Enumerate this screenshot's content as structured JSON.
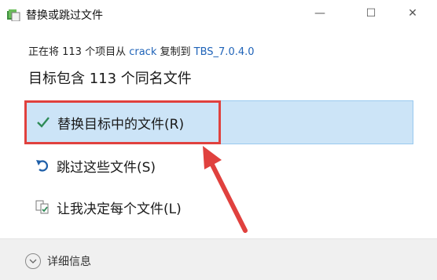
{
  "window": {
    "title": "替换或跳过文件",
    "minimize_glyph": "—",
    "maximize_glyph": "☐",
    "close_glyph": "✕"
  },
  "info": {
    "prefix": "正在将 113 个项目从",
    "source": "crack",
    "middle": "复制到",
    "destination": "TBS_7.0.4.0"
  },
  "heading": "目标包含 113 个同名文件",
  "options": [
    {
      "label": "替换目标中的文件(R)",
      "icon": "checkmark-icon"
    },
    {
      "label": "跳过这些文件(S)",
      "icon": "skip-arrow-icon"
    },
    {
      "label": "让我决定每个文件(L)",
      "icon": "decide-files-icon"
    }
  ],
  "footer": {
    "details_label": "详细信息",
    "icon": "chevron-down-icon"
  },
  "colors": {
    "selected_bg": "#cce4f7",
    "link": "#1f63b8",
    "annotation_red": "#e0413e",
    "check_green": "#2e8b57"
  }
}
